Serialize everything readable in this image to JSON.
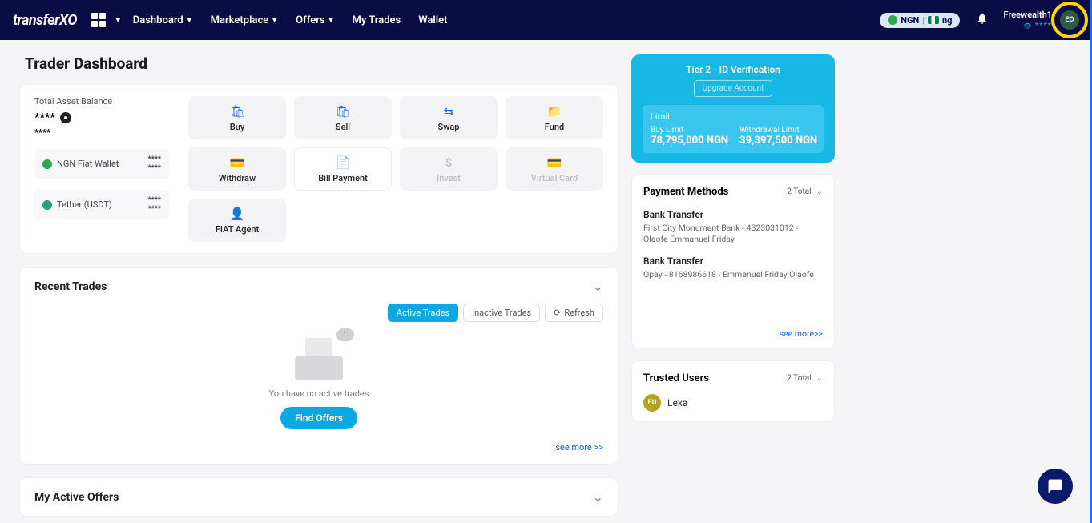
{
  "header": {
    "logo_text": "transferXO",
    "nav": {
      "dashboard": "Dashboard",
      "marketplace": "Marketplace",
      "offers": "Offers",
      "mytrades": "My Trades",
      "wallet": "Wallet"
    },
    "currency": "NGN",
    "country": "ng",
    "username": "Freewealth1",
    "userstars": "****",
    "avatar_initials": "EO"
  },
  "page": {
    "title": "Trader Dashboard"
  },
  "balance": {
    "label": "Total Asset Balance",
    "value": "****",
    "sub": "****",
    "wallets": [
      {
        "name": "NGN Fiat Wallet",
        "amt1": "****",
        "amt2": "****",
        "color": "#2aa84a"
      },
      {
        "name": "Tether (USDT)",
        "amt1": "****",
        "amt2": "****",
        "color": "#26a17b"
      }
    ]
  },
  "actions": {
    "buy": "Buy",
    "sell": "Sell",
    "swap": "Swap",
    "fund": "Fund",
    "withdraw": "Withdraw",
    "billpayment": "Bill Payment",
    "invest": "Invest",
    "virtualcard": "Virtual Card",
    "fiatagent": "FIAT Agent"
  },
  "recent": {
    "title": "Recent Trades",
    "tab_active": "Active Trades",
    "tab_inactive": "Inactive Trades",
    "refresh": "Refresh",
    "empty_text": "You have no active trades",
    "find_offers": "Find Offers",
    "seemore": "see more >>"
  },
  "offers": {
    "title": "My Active Offers"
  },
  "tier": {
    "title": "Tier 2 - ID Verification",
    "upgrade": "Upgrade Account",
    "limit_label": "Limit",
    "buy_label": "Buy Limit",
    "buy_value": "78,795,000 NGN",
    "with_label": "Withdrawal Limit",
    "with_value": "39,397,500 NGN"
  },
  "payment_methods": {
    "title": "Payment Methods",
    "total": "2 Total",
    "items": [
      {
        "type": "Bank Transfer",
        "details": "First City Monument Bank - 4323031012 - Olaofe Emmanuel Friday"
      },
      {
        "type": "Bank Transfer",
        "details": "Opay - 8168986618 - Emmanuel Friday Olaofe"
      }
    ],
    "seemore": "see more>>"
  },
  "trusted": {
    "title": "Trusted Users",
    "total": "2 Total",
    "items": [
      {
        "initials": "EU",
        "name": "Lexa"
      }
    ]
  }
}
